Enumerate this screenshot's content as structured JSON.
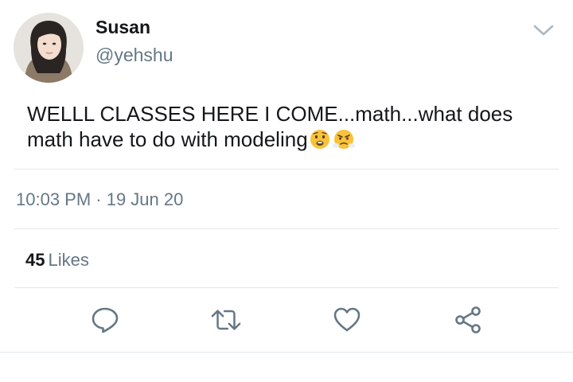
{
  "user": {
    "display_name": "Susan",
    "handle": "@yehshu",
    "avatar_icon": "profile-photo"
  },
  "tweet": {
    "text": "WELLL CLASSES HERE I COME...math...what does math have to do with modeling",
    "emojis": [
      "anguished-face-emoji",
      "face-with-steam-from-nose-emoji"
    ],
    "timestamp": "10:03 PM · 19 Jun 20"
  },
  "stats": {
    "likes_count": "45",
    "likes_label": "Likes"
  },
  "actions": {
    "reply_icon": "reply-icon",
    "retweet_icon": "retweet-icon",
    "like_icon": "heart-icon",
    "share_icon": "share-icon",
    "more_icon": "chevron-down-icon"
  },
  "colors": {
    "text_primary": "#14171a",
    "text_secondary": "#657786",
    "divider": "#e1e8ed",
    "icon": "#657786",
    "emoji_face": "#f8c23a"
  }
}
